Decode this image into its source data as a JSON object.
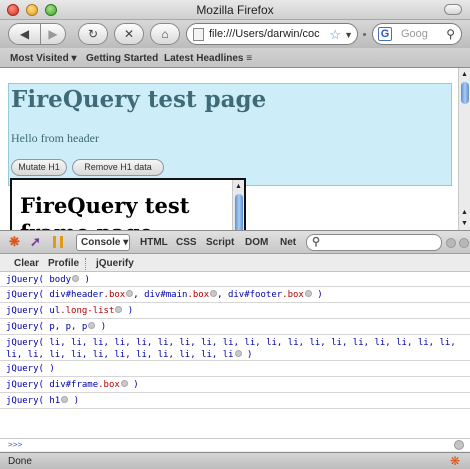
{
  "window": {
    "title": "Mozilla Firefox"
  },
  "nav": {
    "url": "file:///Users/darwin/coc",
    "search_placeholder": "Goog"
  },
  "bookmarks": [
    "Most Visited ▾",
    "Getting Started",
    "Latest Headlines ≡"
  ],
  "page": {
    "h1": "FireQuery test page",
    "hello": "Hello from header",
    "buttons": [
      "Mutate H1",
      "Remove H1 data"
    ],
    "frame_h1_line1": "FireQuery test",
    "frame_h1_line2": "frame page"
  },
  "firebug": {
    "tabs": [
      "Console ▾",
      "HTML",
      "CSS",
      "Script",
      "DOM",
      "Net"
    ],
    "sub_tabs": [
      "Clear",
      "Profile",
      "jQuerify"
    ],
    "rows": [
      {
        "prefix": "jQuery(",
        "parts": [
          {
            "t": "body",
            "c": "tag"
          }
        ],
        "suffix": ")"
      },
      {
        "prefix": "jQuery(",
        "parts": [
          {
            "t": "div#header",
            "c": "tag"
          },
          {
            "t": ".box",
            "c": "cls"
          },
          {
            "t": ", ",
            "c": "sel"
          },
          {
            "t": "div#main",
            "c": "tag"
          },
          {
            "t": ".box",
            "c": "cls"
          },
          {
            "t": ", ",
            "c": "sel"
          },
          {
            "t": "div#footer",
            "c": "tag"
          },
          {
            "t": ".box",
            "c": "cls"
          }
        ],
        "suffix": ")"
      },
      {
        "prefix": "jQuery(",
        "parts": [
          {
            "t": "ul",
            "c": "tag"
          },
          {
            "t": ".long-list",
            "c": "cls"
          }
        ],
        "suffix": ")"
      },
      {
        "prefix": "jQuery(",
        "parts": [
          {
            "t": "p, p, p",
            "c": "tag"
          }
        ],
        "suffix": ")"
      },
      {
        "prefix": "jQuery(",
        "parts": [
          {
            "t": "li, li, li, li, li, li, li, li, li, li, li, li, li, li, li, li, li, li, li, li, li, li, li, li, li, li, li, li, li, li",
            "c": "tag"
          }
        ],
        "suffix": ")"
      },
      {
        "prefix": "jQuery(",
        "parts": [
          {
            "t": " ",
            "c": "sel"
          }
        ],
        "suffix": ")"
      },
      {
        "prefix": "jQuery(",
        "parts": [
          {
            "t": "div#frame",
            "c": "tag"
          },
          {
            "t": ".box",
            "c": "cls"
          }
        ],
        "suffix": ")"
      },
      {
        "prefix": "jQuery(",
        "parts": [
          {
            "t": "h1",
            "c": "tag"
          }
        ],
        "suffix": ")"
      }
    ],
    "prompt": ">>>"
  },
  "status": "Done",
  "icons": {
    "bug": "firebug-icon",
    "inspect": "inspect-icon",
    "pause": "pause-icon"
  }
}
